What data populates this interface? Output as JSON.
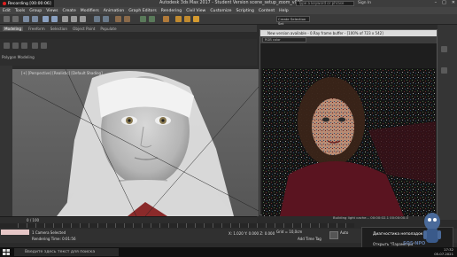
{
  "titlebar": {
    "recording": "Recording [00:00:06]",
    "title": "Autodesk 3ds Max 2017 - Student Version   scene_setup_zoom_v008.max",
    "search_placeholder": "Type a keyword or phrase",
    "sign_in": "Sign In"
  },
  "menu": [
    "Edit",
    "Tools",
    "Group",
    "Views",
    "Create",
    "Modifiers",
    "Animation",
    "Graph Editors",
    "Rendering",
    "Civil View",
    "Customize",
    "Scripting",
    "Content",
    "Help"
  ],
  "toolbar": {
    "selection_set": "Create Selection Set"
  },
  "ribbon": {
    "tabs": [
      "Modeling",
      "Freeform",
      "Selection",
      "Object Paint",
      "Populate"
    ],
    "active": "Modeling",
    "panel_label": "Polygon Modeling"
  },
  "viewport": {
    "label": "[+] [Perspective] [Realistic] [Default Shading]"
  },
  "vfb": {
    "title": "New version available - 0.Ray frame buffer - [100% of 723 x 542]",
    "channel": "RGB color"
  },
  "timeline": {
    "counter": "0 / 100"
  },
  "status": {
    "selection": "1 Camera Selected",
    "render_time": "Rendering Time: 0:01:56",
    "coords": "X: 1.020 Y: 0.000 Z: 0.000",
    "grid": "Grid = 10,0cm",
    "add_time_tag": "Add Time Tag",
    "auto": "Auto",
    "render_status": "Building light cache... 00:00:02.1 00:00:00.0"
  },
  "notification": {
    "title": "Диагностика неполадок",
    "body": "Открыть \"Параметры\""
  },
  "taskbar": {
    "search": "Введите здесь текст для поиска",
    "time": "17:32",
    "date": "05.07.2021"
  },
  "watermark": "SOS NPO",
  "colors": {
    "accent": "#4a90d9",
    "record": "#e02020"
  }
}
